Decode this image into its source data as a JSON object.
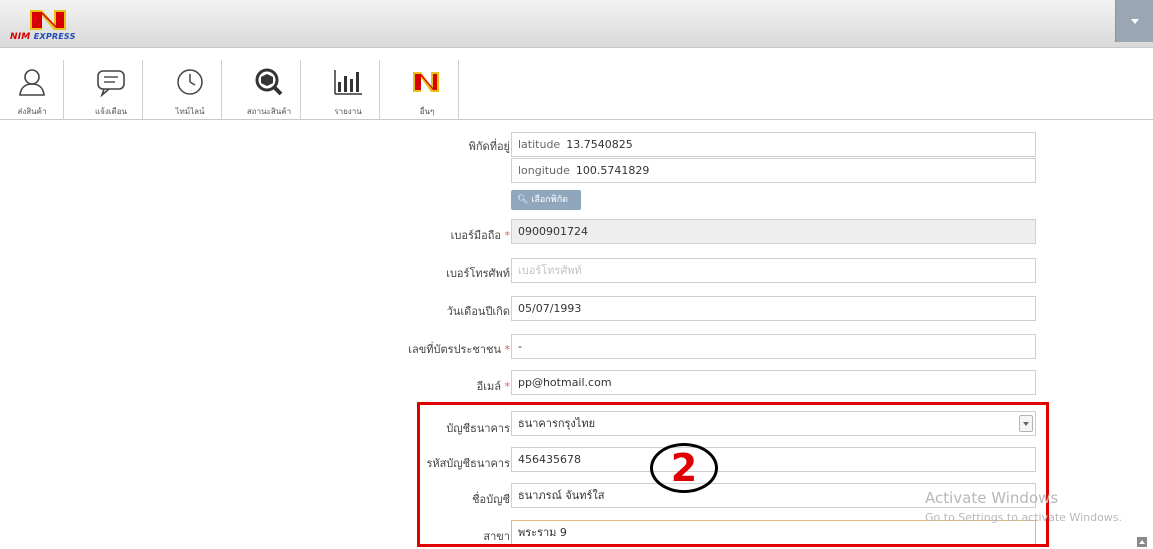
{
  "header": {
    "logo_main": "NIM",
    "logo_sub": "EXPRESS"
  },
  "toolbar": [
    {
      "label": "ส่งสินค้า",
      "icon": "user-icon"
    },
    {
      "label": "แจ้งเตือน",
      "icon": "chat-icon"
    },
    {
      "label": "ไทม์ไลน์",
      "icon": "clock-icon"
    },
    {
      "label": "สถานะสินค้า",
      "icon": "package-search-icon"
    },
    {
      "label": "รายงาน",
      "icon": "bar-chart-icon"
    },
    {
      "label": "อื่นๆ",
      "icon": "nim-logo-icon"
    }
  ],
  "form": {
    "location_label": "พิกัดที่อยู่",
    "latitude_label": "latitude",
    "latitude_value": "13.7540825",
    "longitude_label": "longitude",
    "longitude_value": "100.5741829",
    "pick_button": "เลือกพิกัด",
    "mobile_label": "เบอร์มือถือ",
    "mobile_value": "0900901724",
    "phone_label": "เบอร์โทรศัพท์",
    "phone_placeholder": "เบอร์โทรศัพท์",
    "birthday_label": "วันเดือนปีเกิด",
    "birthday_value": "05/07/1993",
    "id_label": "เลขที่บัตรประชาชน",
    "id_value": "-",
    "email_label": "อีเมล์",
    "email_value": "pp@hotmail.com",
    "bank_label": "บัญชีธนาคาร",
    "bank_value": "ธนาคารกรุงไทย",
    "account_no_label": "รหัสบัญชีธนาคาร",
    "account_no_value": "456435678",
    "account_name_label": "ชื่อบัญชี",
    "account_name_value": "ธนาภรณ์ จันทร์ใส",
    "branch_label": "สาขา",
    "branch_value": "พระราม 9",
    "required_mark": "*"
  },
  "overlay": {
    "step_number": "2"
  },
  "watermark": {
    "line1": "Activate Windows",
    "line2": "Go to Settings to activate Windows."
  },
  "colors": {
    "highlight": "#e00000",
    "required": "#e05a5a",
    "pick_button": "#8fa6bd"
  }
}
